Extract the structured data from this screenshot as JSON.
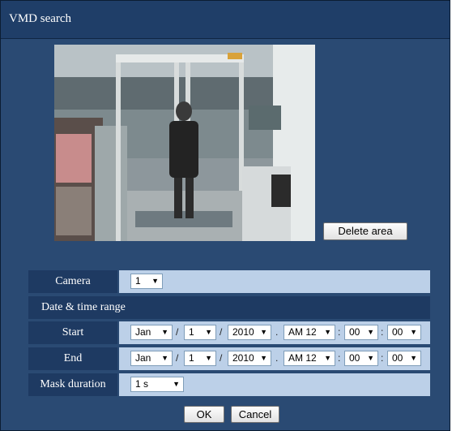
{
  "window": {
    "title": "VMD search"
  },
  "camera_view": {
    "delete_area_label": "Delete area"
  },
  "form": {
    "camera": {
      "label": "Camera",
      "value": "1"
    },
    "range_header": "Date & time range",
    "start": {
      "label": "Start",
      "month": "Jan",
      "day": "1",
      "year": "2010",
      "hour": "AM 12",
      "minute": "00",
      "second": "00"
    },
    "end": {
      "label": "End",
      "month": "Jan",
      "day": "1",
      "year": "2010",
      "hour": "AM 12",
      "minute": "00",
      "second": "00"
    },
    "mask_duration": {
      "label": "Mask duration",
      "value": "1 s"
    },
    "separators": {
      "date": "/",
      "dot": ".",
      "time": ":"
    }
  },
  "buttons": {
    "ok": "OK",
    "cancel": "Cancel"
  },
  "icons": {
    "dropdown": "chevron-down-icon"
  }
}
